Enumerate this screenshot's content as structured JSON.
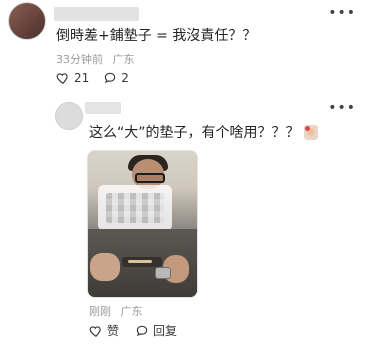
{
  "top_comment": {
    "text": "倒時差+鋪墊子 = 我沒責任？？",
    "meta": {
      "time": "33分钟前",
      "location": "广东"
    },
    "actions": {
      "likes_count": "21",
      "replies_count": "2"
    }
  },
  "reply_comment": {
    "text": "这么“大”的垫子，有个啥用？？？",
    "meta": {
      "time": "刚刚",
      "location": "广东"
    },
    "actions": {
      "like_label": "赞",
      "reply_label": "回复"
    }
  },
  "icons": {
    "more": "ellipsis-icon",
    "like": "heart-icon",
    "reply": "comment-bubble-icon",
    "sticker": "emoji-sticker-icon"
  },
  "colors": {
    "text_primary": "#242424",
    "text_muted": "#9b9b9b",
    "icon_stroke": "#3a3a3a"
  }
}
